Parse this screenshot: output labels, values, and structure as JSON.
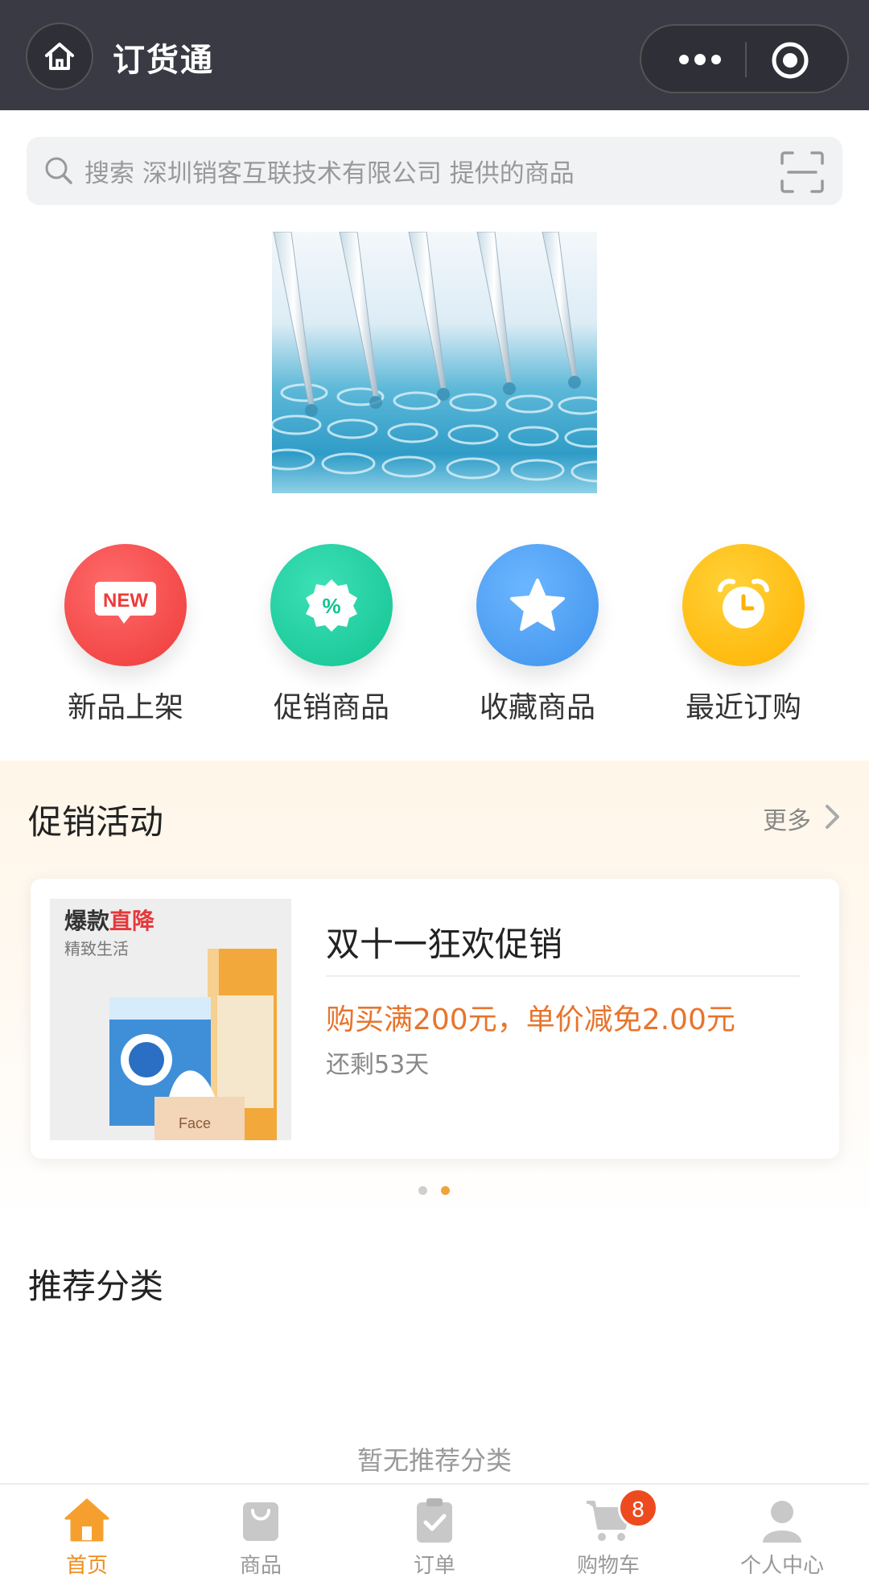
{
  "header": {
    "title": "订货通"
  },
  "search": {
    "placeholder": "搜索  深圳销客互联技术有限公司  提供的商品"
  },
  "quick_entries": [
    {
      "label": "新品上架",
      "icon": "new-icon",
      "color": "#f24a4a"
    },
    {
      "label": "促销商品",
      "icon": "discount-icon",
      "color": "#1ecb9e"
    },
    {
      "label": "收藏商品",
      "icon": "star-icon",
      "color": "#4ea4f5"
    },
    {
      "label": "最近订购",
      "icon": "alarm-clock-icon",
      "color": "#ffbe16"
    }
  ],
  "promo": {
    "title": "促销活动",
    "more": "更多",
    "card": {
      "image_tag_prefix": "爆款",
      "image_tag_highlight": "直降",
      "image_subtag": "精致生活",
      "name": "双十一狂欢促销",
      "rule": "购买满200元，单价减免2.00元",
      "remaining": "还剩53天"
    },
    "carousel": {
      "pages": 2,
      "active": 2
    }
  },
  "recommended": {
    "title": "推荐分类",
    "empty_text": "暂无推荐分类"
  },
  "tabbar": [
    {
      "label": "首页",
      "icon": "home-icon",
      "active": true
    },
    {
      "label": "商品",
      "icon": "bag-icon",
      "active": false
    },
    {
      "label": "订单",
      "icon": "order-icon",
      "active": false
    },
    {
      "label": "购物车",
      "icon": "cart-icon",
      "active": false,
      "badge": "8"
    },
    {
      "label": "个人中心",
      "icon": "user-icon",
      "active": false
    }
  ],
  "colors": {
    "header_bg": "#3a3a45",
    "accent": "#f08c1e",
    "promo_text": "#e8742c",
    "badge": "#ee4a1f"
  }
}
